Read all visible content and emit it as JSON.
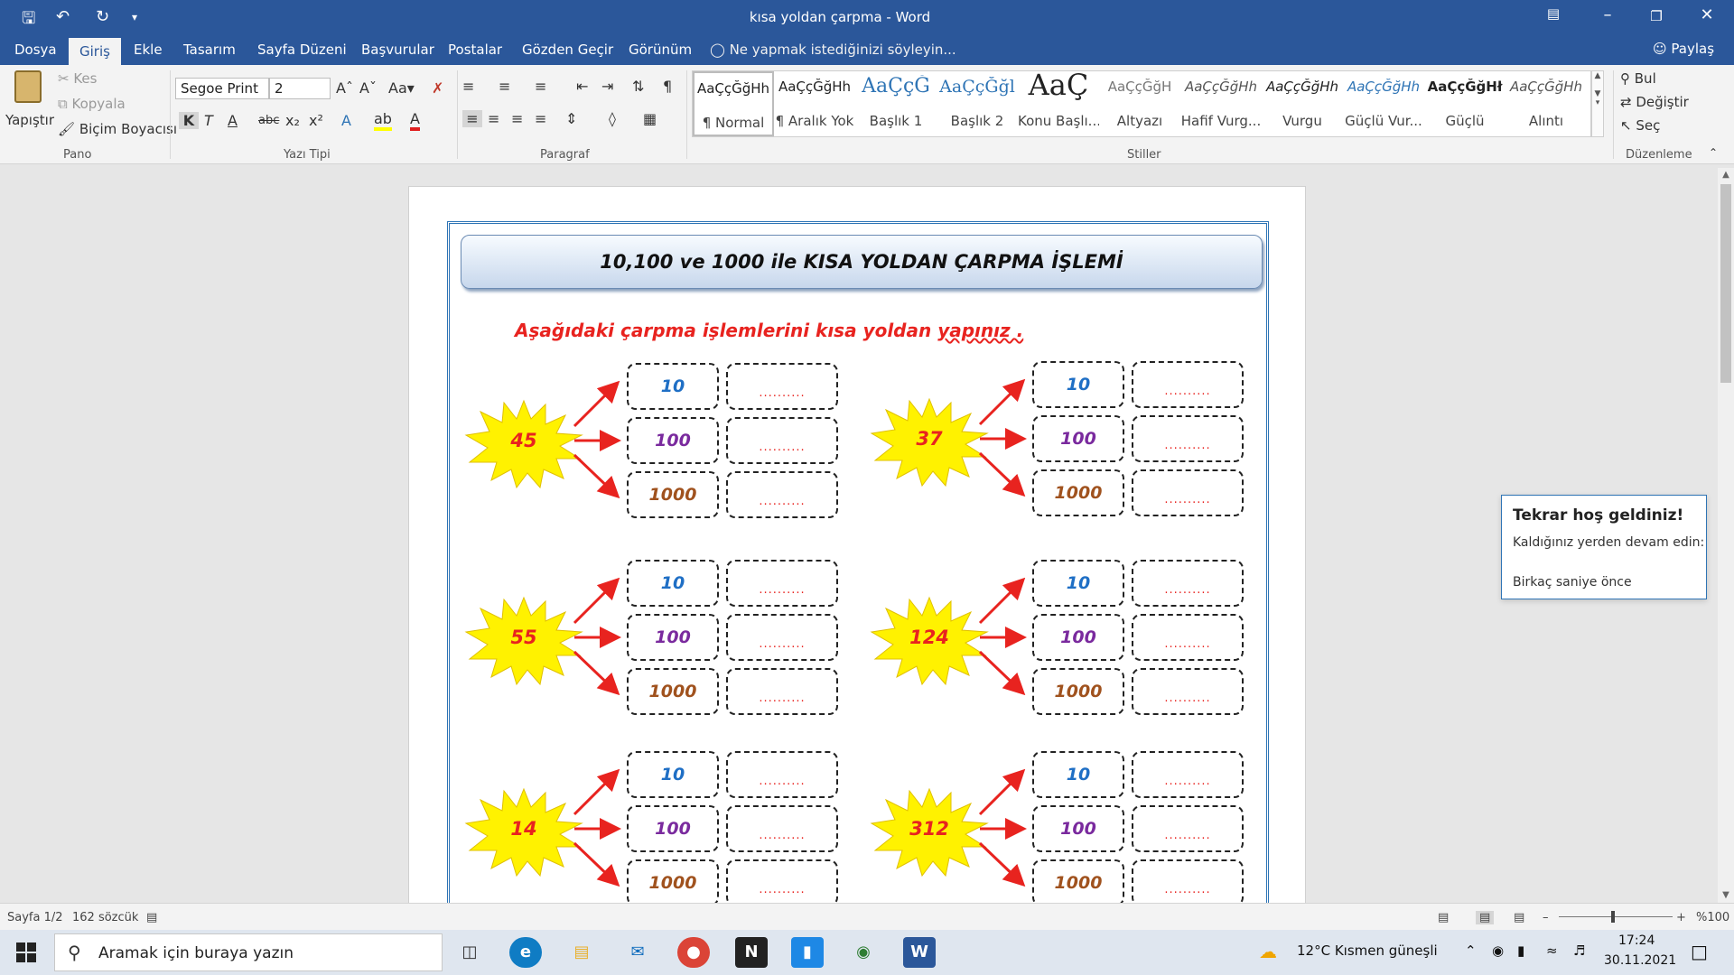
{
  "window": {
    "title": "kısa yoldan çarpma - Word"
  },
  "menu_tabs": [
    {
      "label": "Dosya"
    },
    {
      "label": "Giriş"
    },
    {
      "label": "Ekle"
    },
    {
      "label": "Tasarım"
    },
    {
      "label": "Sayfa Düzeni"
    },
    {
      "label": "Başvurular"
    },
    {
      "label": "Postalar"
    },
    {
      "label": "Gözden Geçir"
    },
    {
      "label": "Görünüm"
    }
  ],
  "tell_me": "Ne yapmak istediğinizi söyleyin...",
  "share_label": "Paylaş",
  "ribbon": {
    "clipboard": {
      "paste": "Yapıştır",
      "cut": "Kes",
      "copy": "Kopyala",
      "format_painter": "Biçim Boyacısı",
      "group_label": "Pano"
    },
    "font": {
      "family": "Segoe Print",
      "size": "2",
      "group_label": "Yazı Tipi",
      "bold": "K",
      "italic": "T",
      "underline": "A",
      "strike": "abc",
      "sub": "x₂",
      "sup": "x²"
    },
    "paragraph": {
      "group_label": "Paragraf"
    },
    "styles": {
      "group_label": "Stiller",
      "items": [
        {
          "sample": "AaÇçĞğHh",
          "name": "¶ Normal"
        },
        {
          "sample": "AaÇçĞğHh",
          "name": "¶ Aralık Yok"
        },
        {
          "sample": "AaÇçĞ",
          "name": "Başlık 1"
        },
        {
          "sample": "AaÇçĞğl",
          "name": "Başlık 2"
        },
        {
          "sample": "AaÇ",
          "name": "Konu Başlı..."
        },
        {
          "sample": "AaÇçĞğH",
          "name": "Altyazı"
        },
        {
          "sample": "AaÇçĞğHh",
          "name": "Hafif Vurg..."
        },
        {
          "sample": "AaÇçĞğHh",
          "name": "Vurgu"
        },
        {
          "sample": "AaÇçĞğHh",
          "name": "Güçlü Vur..."
        },
        {
          "sample": "AaÇçĞğHł",
          "name": "Güçlü"
        },
        {
          "sample": "AaÇçĞğHh",
          "name": "Alıntı"
        }
      ]
    },
    "editing": {
      "group_label": "Düzenleme",
      "find": "Bul",
      "replace": "Değiştir",
      "select": "Seç"
    }
  },
  "document": {
    "banner_title": "10,100 ve 1000 ile KISA YOLDAN ÇARPMA İŞLEMİ",
    "instruction_main": "Aşağıdaki çarpma işlemlerini kısa yoldan ",
    "instruction_tail": "yapınız .",
    "multipliers": [
      "10",
      "100",
      "1000"
    ],
    "answer_placeholder": "..........",
    "numbers": [
      "45",
      "37",
      "55",
      "124",
      "14",
      "312"
    ]
  },
  "toast": {
    "title": "Tekrar hoş geldiniz!",
    "line1": "Kaldığınız yerden devam edin:",
    "line2": "Birkaç saniye önce"
  },
  "statusbar": {
    "page": "Sayfa 1/2",
    "words": "162 sözcük",
    "zoom": "%100"
  },
  "taskbar": {
    "search_placeholder": "Aramak için buraya yazın",
    "weather": "12°C  Kısmen güneşli",
    "time": "17:24",
    "date": "30.11.2021"
  },
  "colors": {
    "word_blue": "#2b579a",
    "accent_red": "#e8231f",
    "burst_yellow": "#fff200"
  }
}
